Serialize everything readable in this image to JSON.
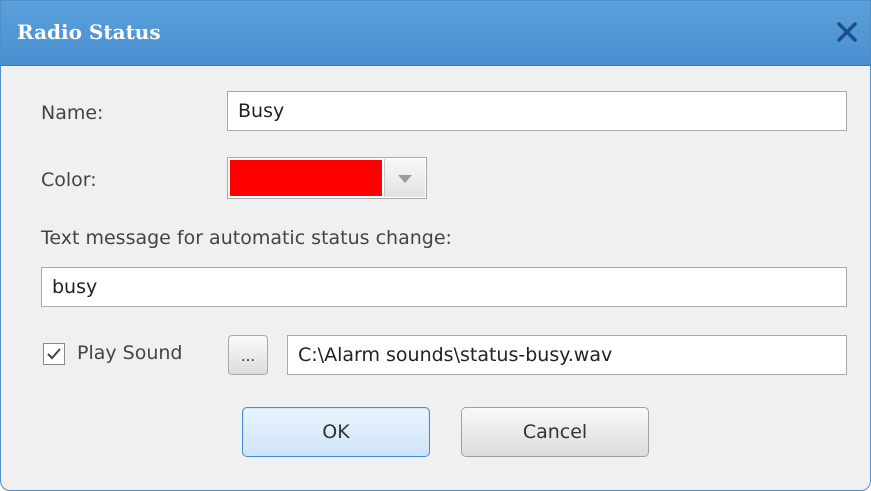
{
  "window": {
    "title": "Radio Status",
    "close_icon": "close-icon"
  },
  "form": {
    "name_label": "Name:",
    "name_value": "Busy",
    "color_label": "Color:",
    "color_value": "#ff0000",
    "text_message_label": "Text message for automatic status change:",
    "text_message_value": "busy",
    "play_sound_label": "Play Sound",
    "play_sound_checked": true,
    "browse_label": "...",
    "sound_path_value": "C:\\Alarm sounds\\status-busy.wav"
  },
  "buttons": {
    "ok_label": "OK",
    "cancel_label": "Cancel"
  },
  "colors": {
    "titlebar": "#4a8fcf",
    "accent": "#3c8fd8"
  }
}
